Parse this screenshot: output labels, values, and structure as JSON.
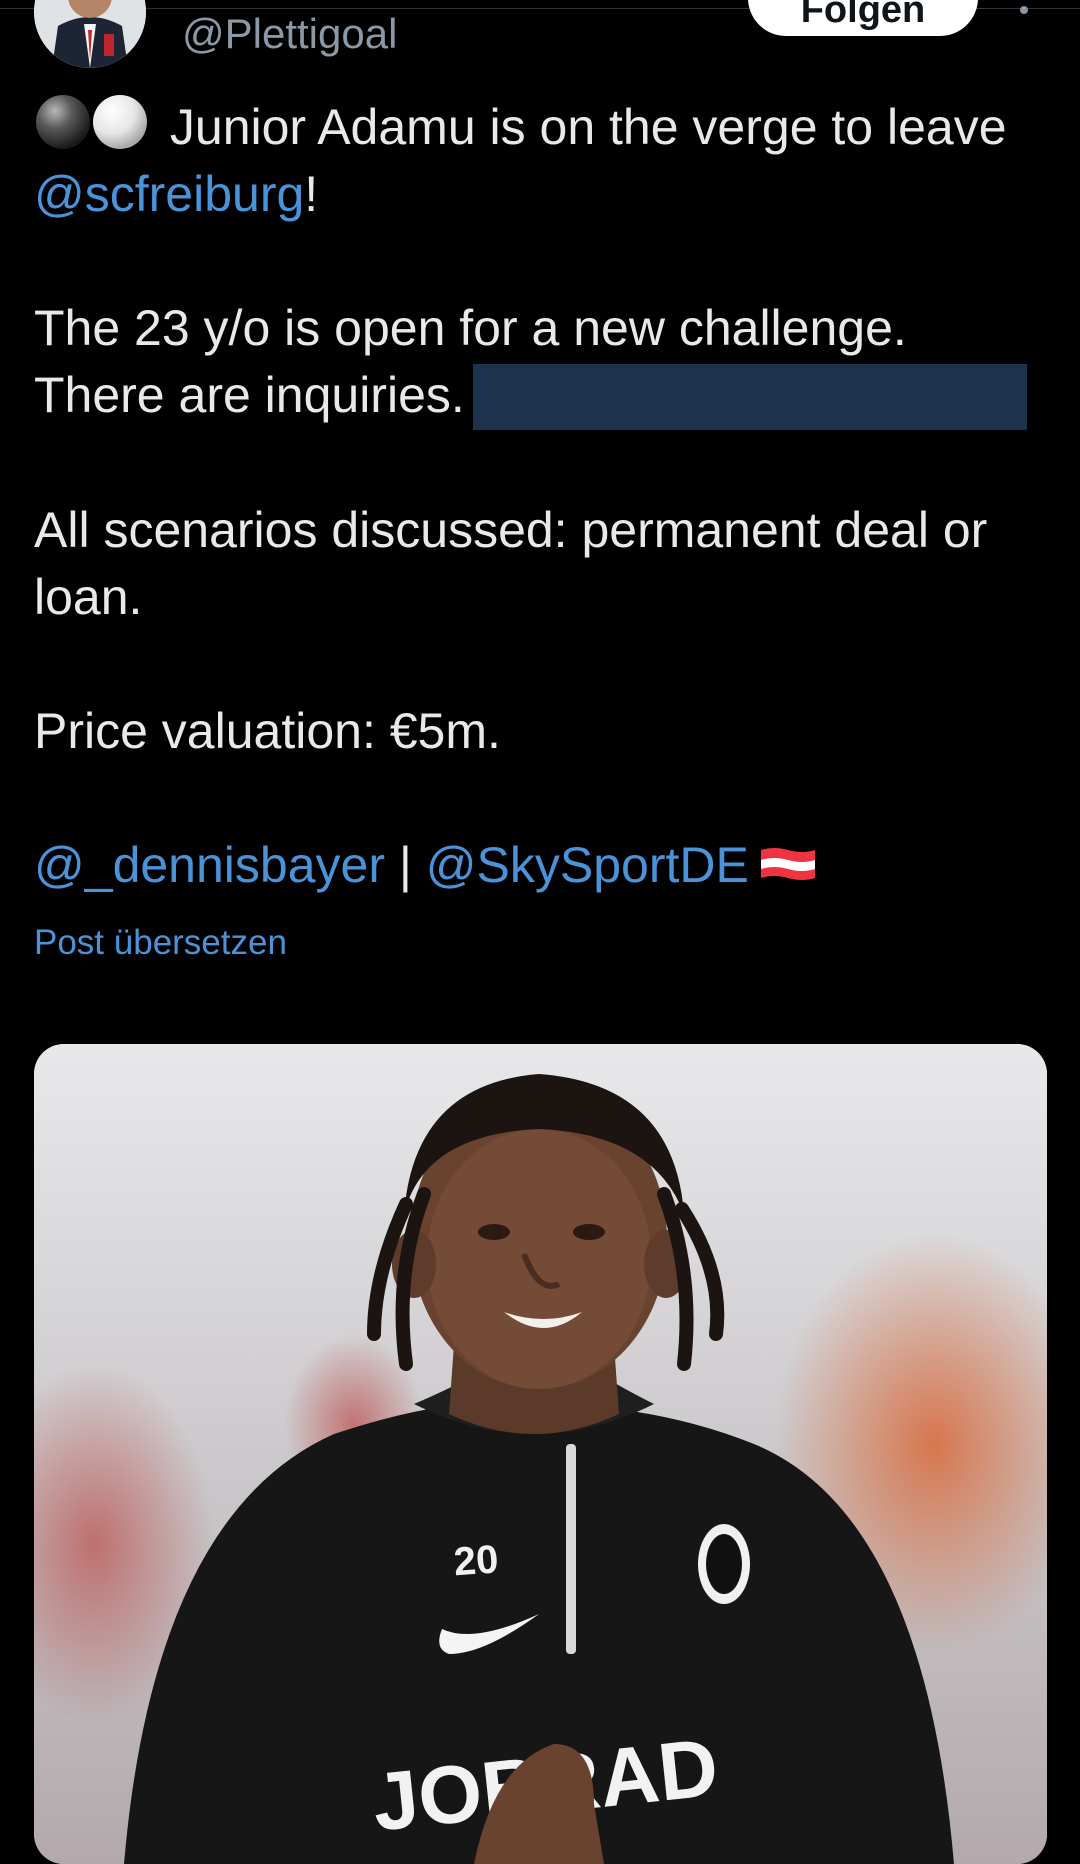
{
  "header": {
    "handle": "@Plettigoal",
    "follow_label": "Folgen",
    "more_icon": "more-dots-icon"
  },
  "tweet": {
    "line1_text": " Junior Adamu is on the verge to leave",
    "mention_scfreiburg": "@scfreiburg",
    "line2_suffix": "!",
    "line3": "The 23 y/o is open for a new challenge.",
    "line4": "There are inquiries.",
    "line5": "All scenarios discussed: permanent deal or",
    "line6": "loan.",
    "line7": "Price valuation: €5m.",
    "mention_dennisbayer": "@_dennisbayer",
    "separator": " | ",
    "mention_skysportde": "@SkySportDE",
    "emoji_icons": [
      "black-ball-icon",
      "white-ball-icon",
      "austria-flag-icon"
    ]
  },
  "translate_label": "Post übersetzen",
  "media": {
    "jersey_number": "20",
    "sponsor_text": "JOBRAD"
  },
  "colors": {
    "background": "#000000",
    "text": "#e7e9ea",
    "link": "#4a93d9",
    "muted": "#8b98a5",
    "redaction": "#1c324d"
  }
}
